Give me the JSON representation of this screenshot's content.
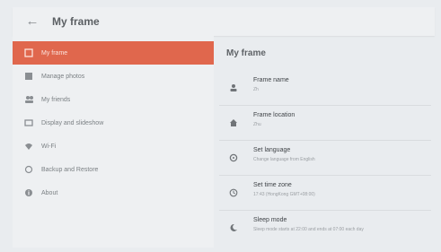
{
  "appbar": {
    "title": "My frame"
  },
  "sidebar": {
    "items": [
      {
        "label": "My frame",
        "icon": "frame-icon",
        "active": true
      },
      {
        "label": "Manage photos",
        "icon": "photos-icon",
        "active": false
      },
      {
        "label": "My friends",
        "icon": "friends-icon",
        "active": false
      },
      {
        "label": "Display and slideshow",
        "icon": "display-icon",
        "active": false
      },
      {
        "label": "Wi-Fi",
        "icon": "wifi-icon",
        "active": false
      },
      {
        "label": "Backup and Restore",
        "icon": "backup-icon",
        "active": false
      },
      {
        "label": "About",
        "icon": "info-icon",
        "active": false
      }
    ]
  },
  "main": {
    "title": "My frame",
    "settings": [
      {
        "icon": "person-icon",
        "title": "Frame name",
        "subtitle": "Zh"
      },
      {
        "icon": "home-icon",
        "title": "Frame location",
        "subtitle": "Zhu"
      },
      {
        "icon": "language-icon",
        "title": "Set language",
        "subtitle": "Change language from English"
      },
      {
        "icon": "clock-icon",
        "title": "Set time zone",
        "subtitle": "17:43 (HongKong GMT+08:00)"
      },
      {
        "icon": "moon-icon",
        "title": "Sleep mode",
        "subtitle": "Sleep mode starts at 22:00 and ends at 07:00 each day"
      }
    ]
  },
  "colors": {
    "accent": "#e0674d",
    "background": "#e9ecef",
    "text": "#3f4347"
  }
}
